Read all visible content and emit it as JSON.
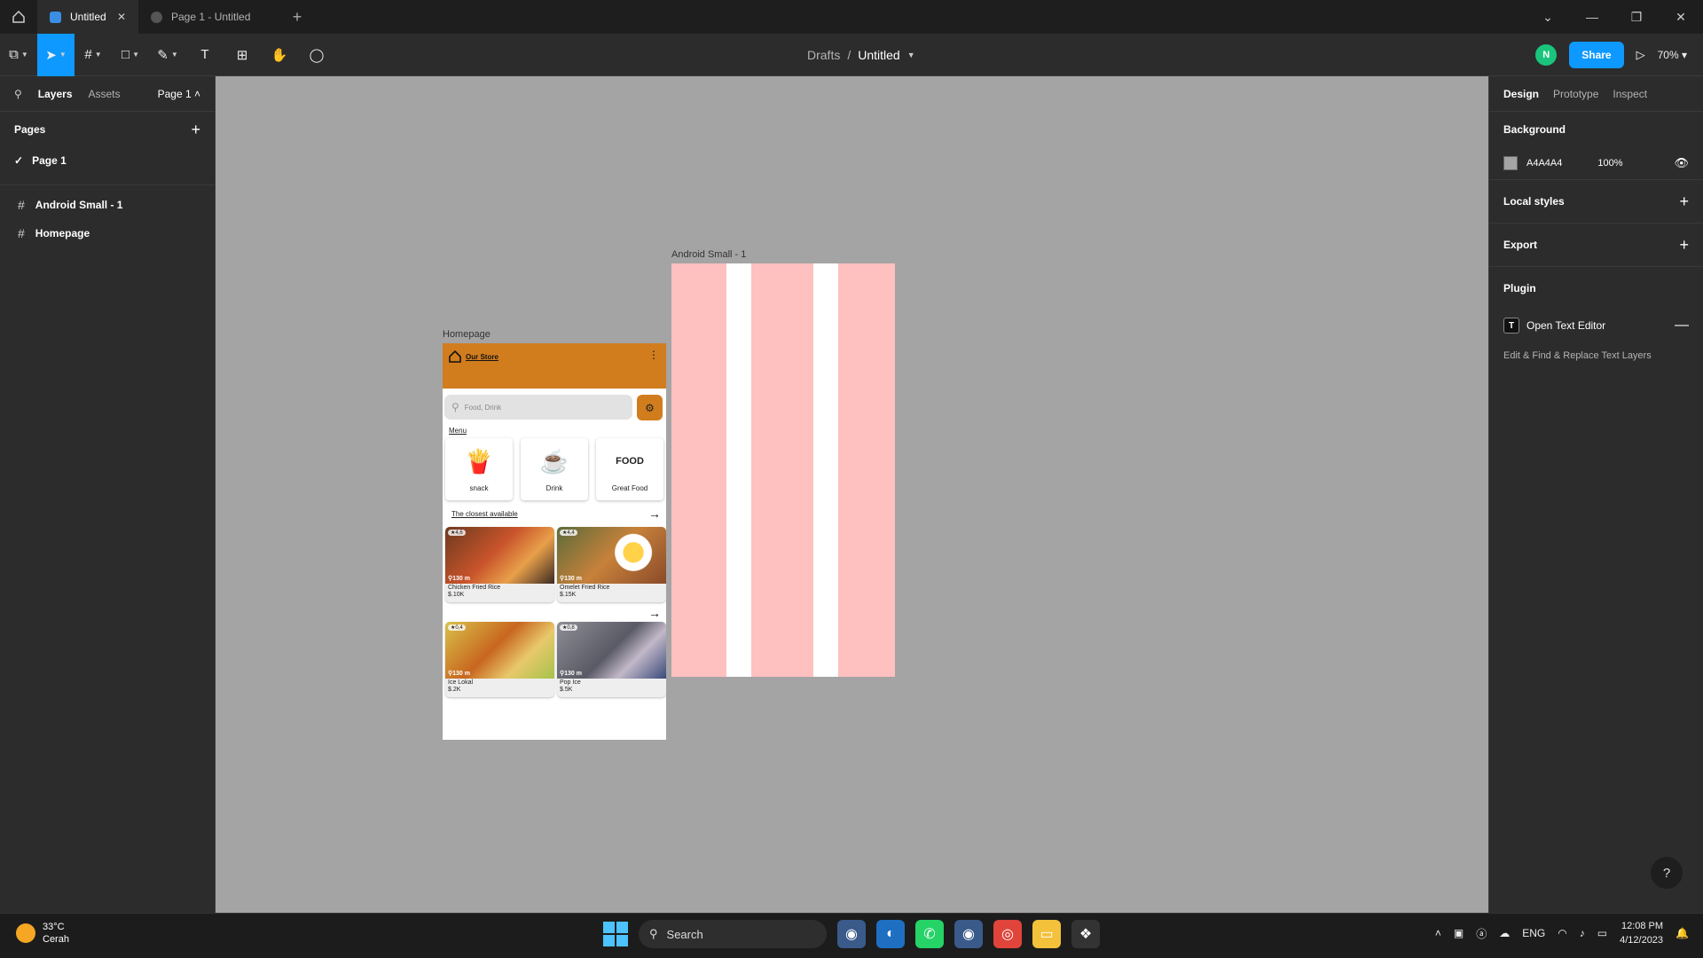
{
  "titlebar": {
    "tabs": [
      {
        "label": "Untitled",
        "active": true
      },
      {
        "label": "Page 1 - Untitled",
        "active": false
      }
    ]
  },
  "toolbar": {
    "breadcrumb_root": "Drafts",
    "breadcrumb_sep": "/",
    "file_name": "Untitled",
    "avatar_initial": "N",
    "share_label": "Share",
    "zoom": "70%"
  },
  "left_panel": {
    "tabs": {
      "layers": "Layers",
      "assets": "Assets",
      "page_select": "Page 1"
    },
    "pages_title": "Pages",
    "pages": [
      "Page 1"
    ],
    "layers": [
      "Android Small - 1",
      "Homepage"
    ]
  },
  "canvas": {
    "background": "#A4A4A4",
    "android_label": "Android Small - 1",
    "homepage_label": "Homepage",
    "homepage": {
      "store_title": "Our Store",
      "search_placeholder": "Food, Drink",
      "menu_label": "Menu",
      "categories": [
        "snack",
        "Drink",
        "Great Food"
      ],
      "closest_label": "The closest available",
      "foods": [
        {
          "rating": "4,6",
          "distance": "130 m",
          "name": "Chicken Fried Rice",
          "price": "$.10K"
        },
        {
          "rating": "4,4",
          "distance": "130 m",
          "name": "Omelet Fried Rice",
          "price": "$.15K"
        },
        {
          "rating": "0,4",
          "distance": "130 m",
          "name": "Ice Lokal",
          "price": "$.2K"
        },
        {
          "rating": "0,8",
          "distance": "130 m",
          "name": "Pop Ice",
          "price": "$.5K"
        }
      ]
    }
  },
  "right_panel": {
    "tabs": {
      "design": "Design",
      "prototype": "Prototype",
      "inspect": "Inspect"
    },
    "background_title": "Background",
    "bg_hex": "A4A4A4",
    "bg_opacity": "100%",
    "local_styles": "Local styles",
    "export": "Export",
    "plugin_title": "Plugin",
    "plugin_name": "Open Text Editor",
    "plugin_desc": "Edit & Find & Replace Text Layers",
    "help": "?"
  },
  "taskbar": {
    "temperature": "33°C",
    "weather": "Cerah",
    "search": "Search",
    "lang": "ENG",
    "time": "12:08 PM",
    "date": "4/12/2023"
  }
}
